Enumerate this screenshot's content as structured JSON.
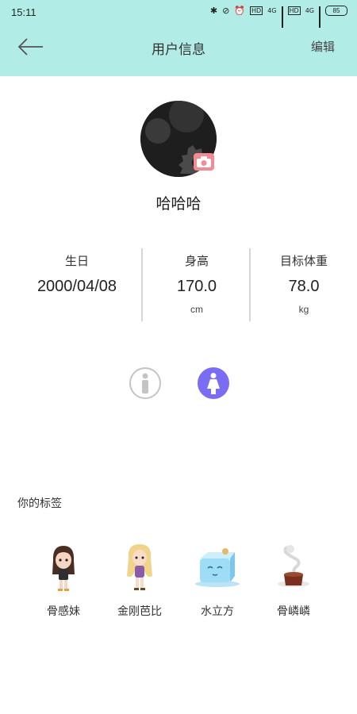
{
  "status_bar": {
    "time": "15:11",
    "network_1": "4G",
    "network_2": "4G",
    "battery": "85"
  },
  "nav": {
    "title": "用户信息",
    "edit_label": "编辑"
  },
  "profile": {
    "name": "哈哈哈"
  },
  "stats": [
    {
      "label": "生日",
      "value": "2000/04/08",
      "unit": ""
    },
    {
      "label": "身高",
      "value": "170.0",
      "unit": "cm"
    },
    {
      "label": "目标体重",
      "value": "78.0",
      "unit": "kg"
    }
  ],
  "gender": {
    "selected": "female",
    "accent": "#7b6cf6"
  },
  "tags": {
    "title": "你的标签",
    "items": [
      {
        "label": "骨感妹",
        "icon": "skinny-girl-icon"
      },
      {
        "label": "金刚芭比",
        "icon": "muscular-barbie-icon"
      },
      {
        "label": "水立方",
        "icon": "ice-cube-icon"
      },
      {
        "label": "骨嶙嶙",
        "icon": "bony-figure-icon"
      }
    ]
  },
  "colors": {
    "header_bg": "#b2ece6",
    "camera_badge": "#f28b93"
  }
}
